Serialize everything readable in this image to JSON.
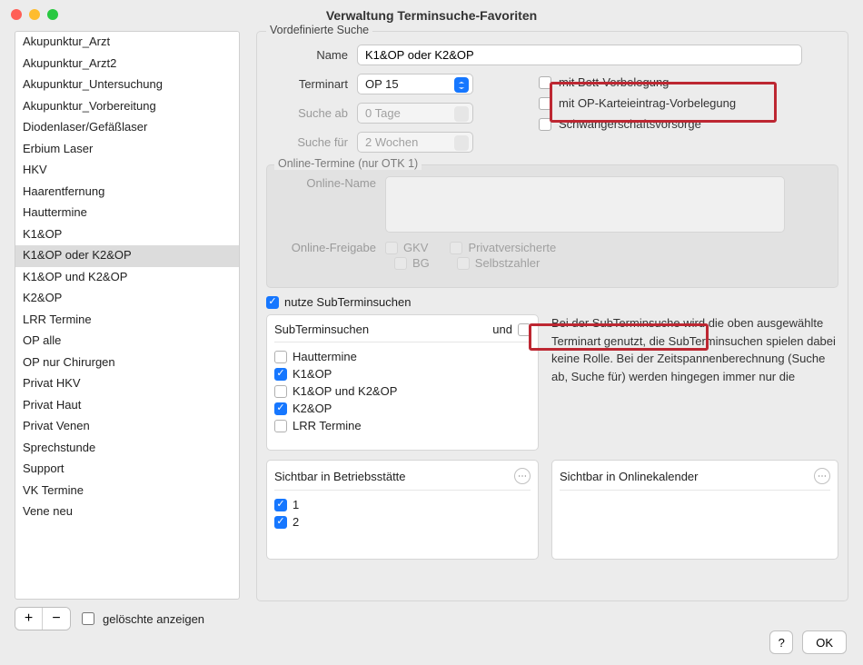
{
  "window": {
    "title": "Verwaltung Terminsuche-Favoriten"
  },
  "leftList": {
    "items": [
      "Akupunktur_Arzt",
      "Akupunktur_Arzt2",
      "Akupunktur_Untersuchung",
      "Akupunktur_Vorbereitung",
      "Diodenlaser/Gefäßlaser",
      "Erbium Laser",
      "HKV",
      "Haarentfernung",
      "Hauttermine",
      "K1&OP",
      "K1&OP oder K2&OP",
      "K1&OP und K2&OP",
      "K2&OP",
      "LRR Termine",
      "OP alle",
      "OP nur Chirurgen",
      "Privat HKV",
      "Privat Haut",
      "Privat Venen",
      "Sprechstunde",
      "Support",
      "VK Termine",
      "Vene neu"
    ],
    "selectedIndex": 10
  },
  "leftbar": {
    "add": "+",
    "remove": "−",
    "showDeleted": "gelöschte anzeigen"
  },
  "group_vordef": {
    "legend": "Vordefinierte Suche",
    "name_label": "Name",
    "name_value": "K1&OP oder K2&OP",
    "terminart_label": "Terminart",
    "terminart_value": "OP 15",
    "sucheab_label": "Suche ab",
    "sucheab_value": "0 Tage",
    "suchefuer_label": "Suche für",
    "suchefuer_value": "2 Wochen",
    "opt_bett": "mit Bett-Vorbelegung",
    "opt_opkartei": "mit OP-Karteieintrag-Vorbelegung",
    "opt_schwanger": "Schwangerschaftsvorsorge"
  },
  "online": {
    "legend": "Online-Termine (nur OTK 1)",
    "name_label": "Online-Name",
    "freigabe_label": "Online-Freigabe",
    "gkv": "GKV",
    "priv": "Privatversicherte",
    "bg": "BG",
    "selbst": "Selbstzahler"
  },
  "sub": {
    "use_label": "nutze SubTerminsuchen",
    "header": "SubTerminsuchen",
    "und": "und",
    "options": [
      {
        "label": "Hauttermine",
        "checked": false
      },
      {
        "label": "K1&OP",
        "checked": true
      },
      {
        "label": "K1&OP und K2&OP",
        "checked": false
      },
      {
        "label": "K2&OP",
        "checked": true
      },
      {
        "label": "LRR Termine",
        "checked": false
      }
    ],
    "info": "Bei der SubTerminsuche wird die oben ausgewählte Terminart genutzt, die SubTerminsuchen spielen dabei keine Rolle. Bei der Zeitspannenberechnung (Suche ab, Suche für) werden hingegen immer nur die"
  },
  "bs": {
    "header": "Sichtbar in Betriebsstätte",
    "options": [
      {
        "label": "1",
        "checked": true
      },
      {
        "label": "2",
        "checked": true
      }
    ]
  },
  "okal": {
    "header": "Sichtbar in Onlinekalender"
  },
  "footer": {
    "help": "?",
    "ok": "OK"
  }
}
